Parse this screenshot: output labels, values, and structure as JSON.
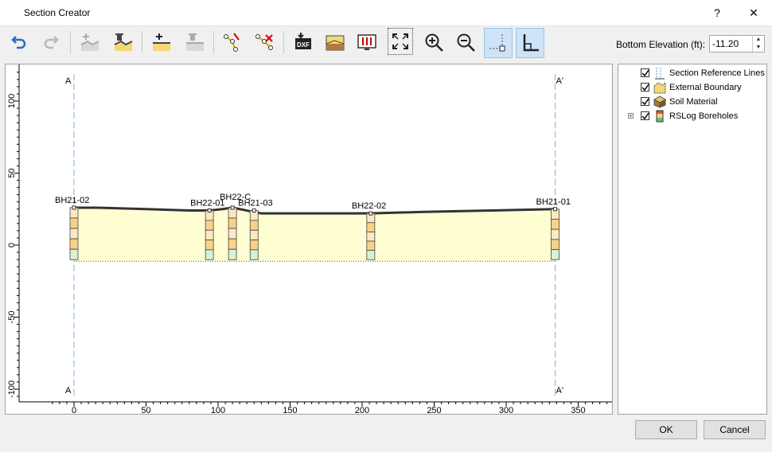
{
  "window": {
    "title": "Section Creator",
    "help_label": "?",
    "close_label": "✕"
  },
  "toolbar": {
    "tools": [
      {
        "name": "undo"
      },
      {
        "name": "redo"
      },
      {
        "name": "add-surface"
      },
      {
        "name": "delete-surface"
      },
      {
        "name": "add-layer"
      },
      {
        "name": "delete-layer"
      },
      {
        "name": "add-vertex"
      },
      {
        "name": "delete-vertex"
      },
      {
        "name": "export-dxf"
      },
      {
        "name": "import-image"
      },
      {
        "name": "display-options"
      },
      {
        "name": "zoom-extents"
      },
      {
        "name": "zoom-in"
      },
      {
        "name": "zoom-out"
      },
      {
        "name": "snap"
      },
      {
        "name": "ortho"
      }
    ]
  },
  "bottom_elevation": {
    "label": "Bottom Elevation (ft):",
    "value": "-11.20"
  },
  "plot": {
    "left_marker": "A",
    "right_marker": "A'",
    "x_ticks": [
      "0",
      "50",
      "100",
      "150",
      "200",
      "250",
      "300",
      "350"
    ],
    "y_ticks": [
      "100",
      "50",
      "0",
      "-50",
      "-100"
    ],
    "boreholes": [
      {
        "name": "BH21-02",
        "x": 0
      },
      {
        "name": "BH22-01",
        "x": 94
      },
      {
        "name": "BH22-C",
        "x": 110
      },
      {
        "name": "BH21-03",
        "x": 125
      },
      {
        "name": "BH22-02",
        "x": 206
      },
      {
        "name": "BH21-01",
        "x": 334
      }
    ]
  },
  "tree": {
    "items": [
      {
        "label": "Section Reference Lines",
        "checked": true
      },
      {
        "label": "External Boundary",
        "checked": true
      },
      {
        "label": "Soil Material",
        "checked": true
      },
      {
        "label": "RSLog Boreholes",
        "checked": true
      }
    ]
  },
  "buttons": {
    "ok": "OK",
    "cancel": "Cancel"
  },
  "colors": {
    "fill": "#fffed2",
    "accent": "#2b6cc4",
    "selected": "#cde3f7"
  }
}
